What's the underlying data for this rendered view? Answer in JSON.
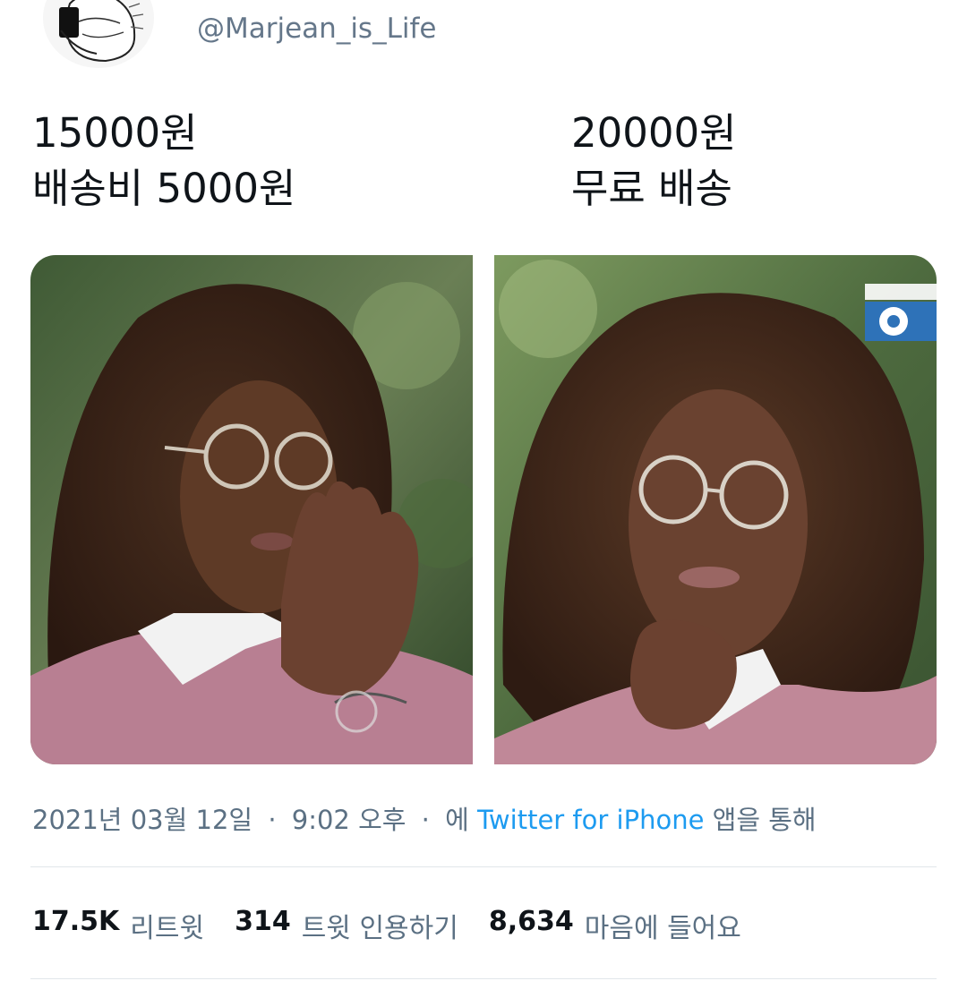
{
  "profile": {
    "handle": "@Marjean_is_Life",
    "avatar_icon": "sketch-person-holding-phone-avatar"
  },
  "tweet": {
    "left_text": [
      "15000원",
      "배송비 5000원"
    ],
    "right_text": [
      "20000원",
      "무료 배송"
    ],
    "photos": [
      {
        "icon": "photo-woman-glasses-raised-hand",
        "overlay_logo": "cbs-eye-logo"
      },
      {
        "icon": "photo-woman-glasses-chin-on-fist",
        "overlay_logo": "cbs-eye-logo"
      }
    ]
  },
  "meta": {
    "date": "2021년 03월 12일",
    "time": "9:02 오후",
    "prefix": "에",
    "source": "Twitter for iPhone",
    "suffix": "앱을 통해",
    "separator": "·"
  },
  "stats": {
    "retweets": {
      "value": "17.5K",
      "label": "리트윗"
    },
    "quotes": {
      "value": "314",
      "label": "트윗 인용하기"
    },
    "likes": {
      "value": "8,634",
      "label": "마음에 들어요"
    }
  },
  "colors": {
    "text": "#0f1419",
    "secondary": "#5b7083",
    "link": "#1d9bf0",
    "divider": "#e1e6ea"
  }
}
